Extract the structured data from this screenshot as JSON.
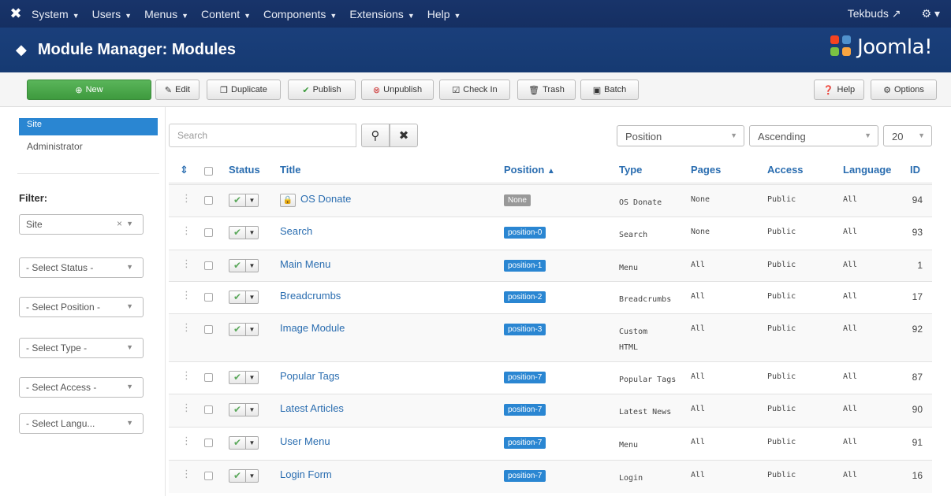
{
  "topnav": {
    "menus": [
      "System",
      "Users",
      "Menus",
      "Content",
      "Components",
      "Extensions",
      "Help"
    ],
    "user": "Tekbuds",
    "settings_caret": "▾"
  },
  "header": {
    "title": "Module Manager: Modules",
    "brand": "Joomla!"
  },
  "toolbar": {
    "new": "New",
    "edit": "Edit",
    "duplicate": "Duplicate",
    "publish": "Publish",
    "unpublish": "Unpublish",
    "checkin": "Check In",
    "trash": "Trash",
    "batch": "Batch",
    "help": "Help",
    "options": "Options"
  },
  "sidebar": {
    "site": "Site",
    "administrator": "Administrator",
    "filter_label": "Filter:",
    "filters": [
      "Site",
      "- Select Status -",
      "- Select Position -",
      "- Select Type -",
      "- Select Access -",
      "- Select Langu..."
    ]
  },
  "search": {
    "placeholder": "Search",
    "sort_field": "Position",
    "sort_dir": "Ascending",
    "limit": "20"
  },
  "table": {
    "headers": {
      "status": "Status",
      "title": "Title",
      "position": "Position",
      "type": "Type",
      "pages": "Pages",
      "access": "Access",
      "language": "Language",
      "id": "ID"
    },
    "rows": [
      {
        "title": "OS Donate",
        "locked": true,
        "position": "None",
        "type": "OS Donate",
        "type2": "",
        "pages": "None",
        "access": "Public",
        "language": "All",
        "id": "94"
      },
      {
        "title": "Search",
        "locked": false,
        "position": "position-0",
        "type": "Search",
        "type2": "",
        "pages": "None",
        "access": "Public",
        "language": "All",
        "id": "93"
      },
      {
        "title": "Main Menu",
        "locked": false,
        "position": "position-1",
        "type": "Menu",
        "type2": "",
        "pages": "All",
        "access": "Public",
        "language": "All",
        "id": "1"
      },
      {
        "title": "Breadcrumbs",
        "locked": false,
        "position": "position-2",
        "type": "Breadcrumbs",
        "type2": "",
        "pages": "All",
        "access": "Public",
        "language": "All",
        "id": "17"
      },
      {
        "title": "Image Module",
        "locked": false,
        "position": "position-3",
        "type": "Custom",
        "type2": "HTML",
        "pages": "All",
        "access": "Public",
        "language": "All",
        "id": "92"
      },
      {
        "title": "Popular Tags",
        "locked": false,
        "position": "position-7",
        "type": "Popular Tags",
        "type2": "",
        "pages": "All",
        "access": "Public",
        "language": "All",
        "id": "87"
      },
      {
        "title": "Latest Articles",
        "locked": false,
        "position": "position-7",
        "type": "Latest News",
        "type2": "",
        "pages": "All",
        "access": "Public",
        "language": "All",
        "id": "90"
      },
      {
        "title": "User Menu",
        "locked": false,
        "position": "position-7",
        "type": "Menu",
        "type2": "",
        "pages": "All",
        "access": "Public",
        "language": "All",
        "id": "91"
      },
      {
        "title": "Login Form",
        "locked": false,
        "position": "position-7",
        "type": "Login",
        "type2": "",
        "pages": "All",
        "access": "Public",
        "language": "All",
        "id": "16"
      }
    ]
  }
}
